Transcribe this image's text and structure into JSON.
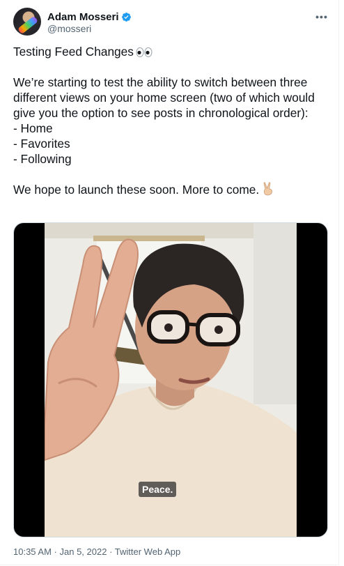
{
  "author": {
    "display_name": "Adam Mosseri",
    "handle": "@mosseri",
    "verified": true
  },
  "tweet": {
    "title_line": "Testing Feed Changes",
    "title_emoji": "eyes-emoji",
    "paragraph": "We’re starting to test the ability to switch between three different views on your home screen (two of which would give you the option to see posts in chronological order):",
    "list": [
      "- Home",
      "- Favorites",
      "- Following"
    ],
    "closing": "We hope to launch these soon. More to come.",
    "closing_emoji": "victory-hand-emoji"
  },
  "media": {
    "caption": "Peace."
  },
  "meta": {
    "time": "10:35 AM",
    "separator1": " · ",
    "date": "Jan 5, 2022",
    "separator2": " · ",
    "source": "Twitter Web App"
  },
  "colors": {
    "text": "#0f1419",
    "secondary": "#536471",
    "verified": "#1d9bf0",
    "border": "#cfd9de"
  }
}
